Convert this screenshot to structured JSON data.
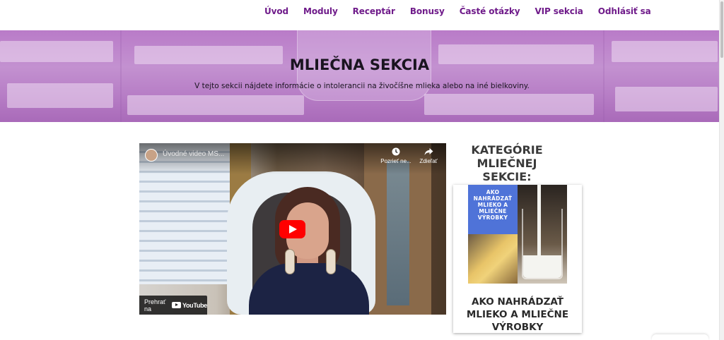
{
  "nav": {
    "items": [
      "Úvod",
      "Moduly",
      "Receptár",
      "Bonusy",
      "Časté otázky",
      "VIP sekcia",
      "Odhlásiť sa"
    ],
    "color": "#6f1b8a"
  },
  "hero": {
    "title": "MLIEČNA SEKCIA",
    "subtitle": "V tejto sekcii nájdete informácie o intolerancii na živočíšne mlieka alebo na iné bielkoviny.",
    "background_color": "#b97bc8"
  },
  "video": {
    "title": "Úvodné video MS...",
    "watch_later_label": "Pozrieť ne...",
    "share_label": "Zdieľať",
    "watch_on_label": "Prehrať na",
    "platform": "YouTube",
    "play_button_color": "#ff0000",
    "icons": [
      "clock-icon",
      "share-icon",
      "play-icon",
      "youtube-logo-icon"
    ]
  },
  "categories": {
    "heading": "KATEGÓRIE MLIEČNEJ SEKCIE:",
    "items": [
      {
        "image_text": "AKO NAHRÁDZAŤ MLIEKO A MLIEČNE VÝROBKY",
        "title": "AKO NAHRÁDZAŤ MLIEKO A MLIEČNE VÝROBKY"
      }
    ]
  }
}
